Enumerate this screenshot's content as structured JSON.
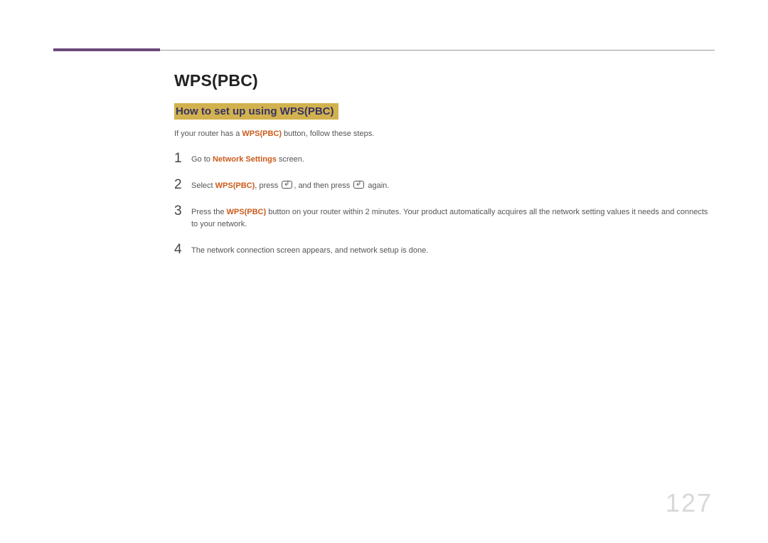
{
  "heading": "WPS(PBC)",
  "subheading": "How to set up using WPS(PBC)",
  "intro": {
    "prefix": "If your router has a ",
    "strong": "WPS(PBC)",
    "suffix": " button, follow these steps."
  },
  "steps": [
    {
      "num": "1",
      "parts": {
        "a": "Go to ",
        "b": "Network Settings",
        "c": " screen."
      }
    },
    {
      "num": "2",
      "parts": {
        "a": "Select ",
        "b": "WPS(PBC)",
        "c": ", press ",
        "d": ", and then press ",
        "e": " again."
      }
    },
    {
      "num": "3",
      "parts": {
        "a": "Press the ",
        "b": "WPS(PBC)",
        "c": " button on your router within 2 minutes. Your product automatically acquires all the network setting values it needs and connects to your network."
      }
    },
    {
      "num": "4",
      "parts": {
        "a": "The network connection screen appears, and network setup is done."
      }
    }
  ],
  "pageNumber": "127"
}
